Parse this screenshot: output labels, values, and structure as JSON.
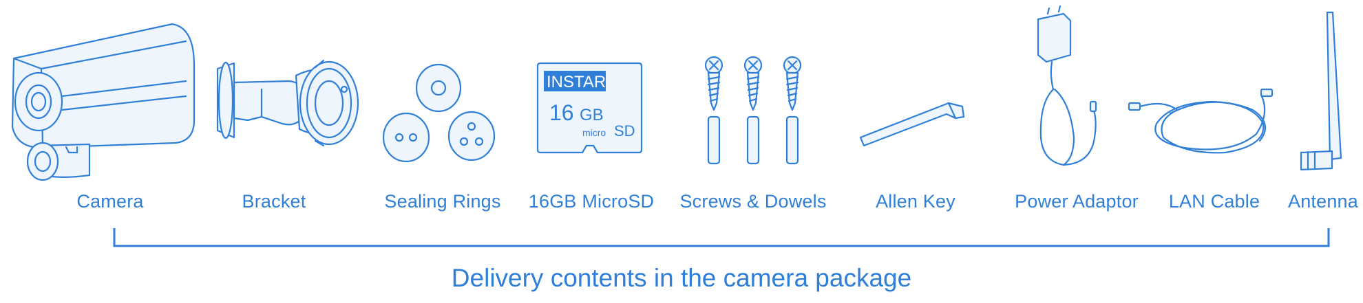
{
  "items": [
    {
      "label": "Camera"
    },
    {
      "label": "Bracket"
    },
    {
      "label": "Sealing Rings"
    },
    {
      "label": "16GB MicroSD"
    },
    {
      "label": "Screws & Dowels"
    },
    {
      "label": "Allen Key"
    },
    {
      "label": "Power Adaptor"
    },
    {
      "label": "LAN Cable"
    },
    {
      "label": "Antenna"
    }
  ],
  "sdcard": {
    "brand": "INSTAR",
    "capacity_num": "16",
    "capacity_unit": "GB",
    "type_small": "micro",
    "type_big": "SD"
  },
  "caption": "Delivery contents in the camera package",
  "colors": {
    "accent": "#2f7fd8"
  }
}
